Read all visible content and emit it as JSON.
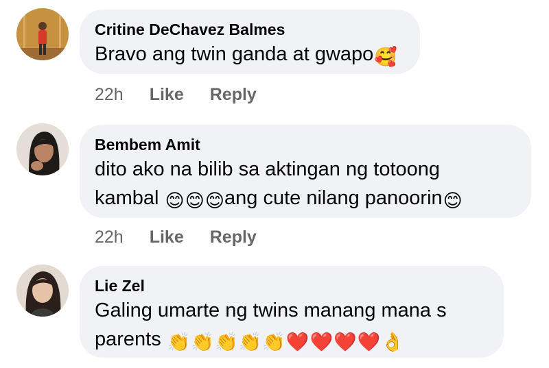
{
  "comments": [
    {
      "author": "Critine DeChavez Balmes",
      "lines": [
        {
          "text": "Bravo ang twin ganda at gwapo",
          "emojis": [
            "🥰"
          ]
        }
      ],
      "time": "22h",
      "like_label": "Like",
      "reply_label": "Reply"
    },
    {
      "author": "Bembem Amit",
      "lines": [
        {
          "text": "dito ako na bilib sa aktingan ng totoong",
          "emojis": []
        },
        {
          "text_pre": "kambal ",
          "pre_emojis": [
            "😊",
            "😊",
            "😊"
          ],
          "text": "ang cute nilang panoorin",
          "emojis": [
            "😊"
          ]
        }
      ],
      "time": "22h",
      "like_label": "Like",
      "reply_label": "Reply"
    },
    {
      "author": "Lie Zel",
      "lines": [
        {
          "text": "Galing umarte ng twins manang mana s",
          "emojis": []
        },
        {
          "text": "parents ",
          "emojis": [
            "👏",
            "👏",
            "👏",
            "👏",
            "👏",
            "❤️",
            "❤️",
            "❤️",
            "❤️",
            "👌"
          ]
        }
      ]
    }
  ]
}
